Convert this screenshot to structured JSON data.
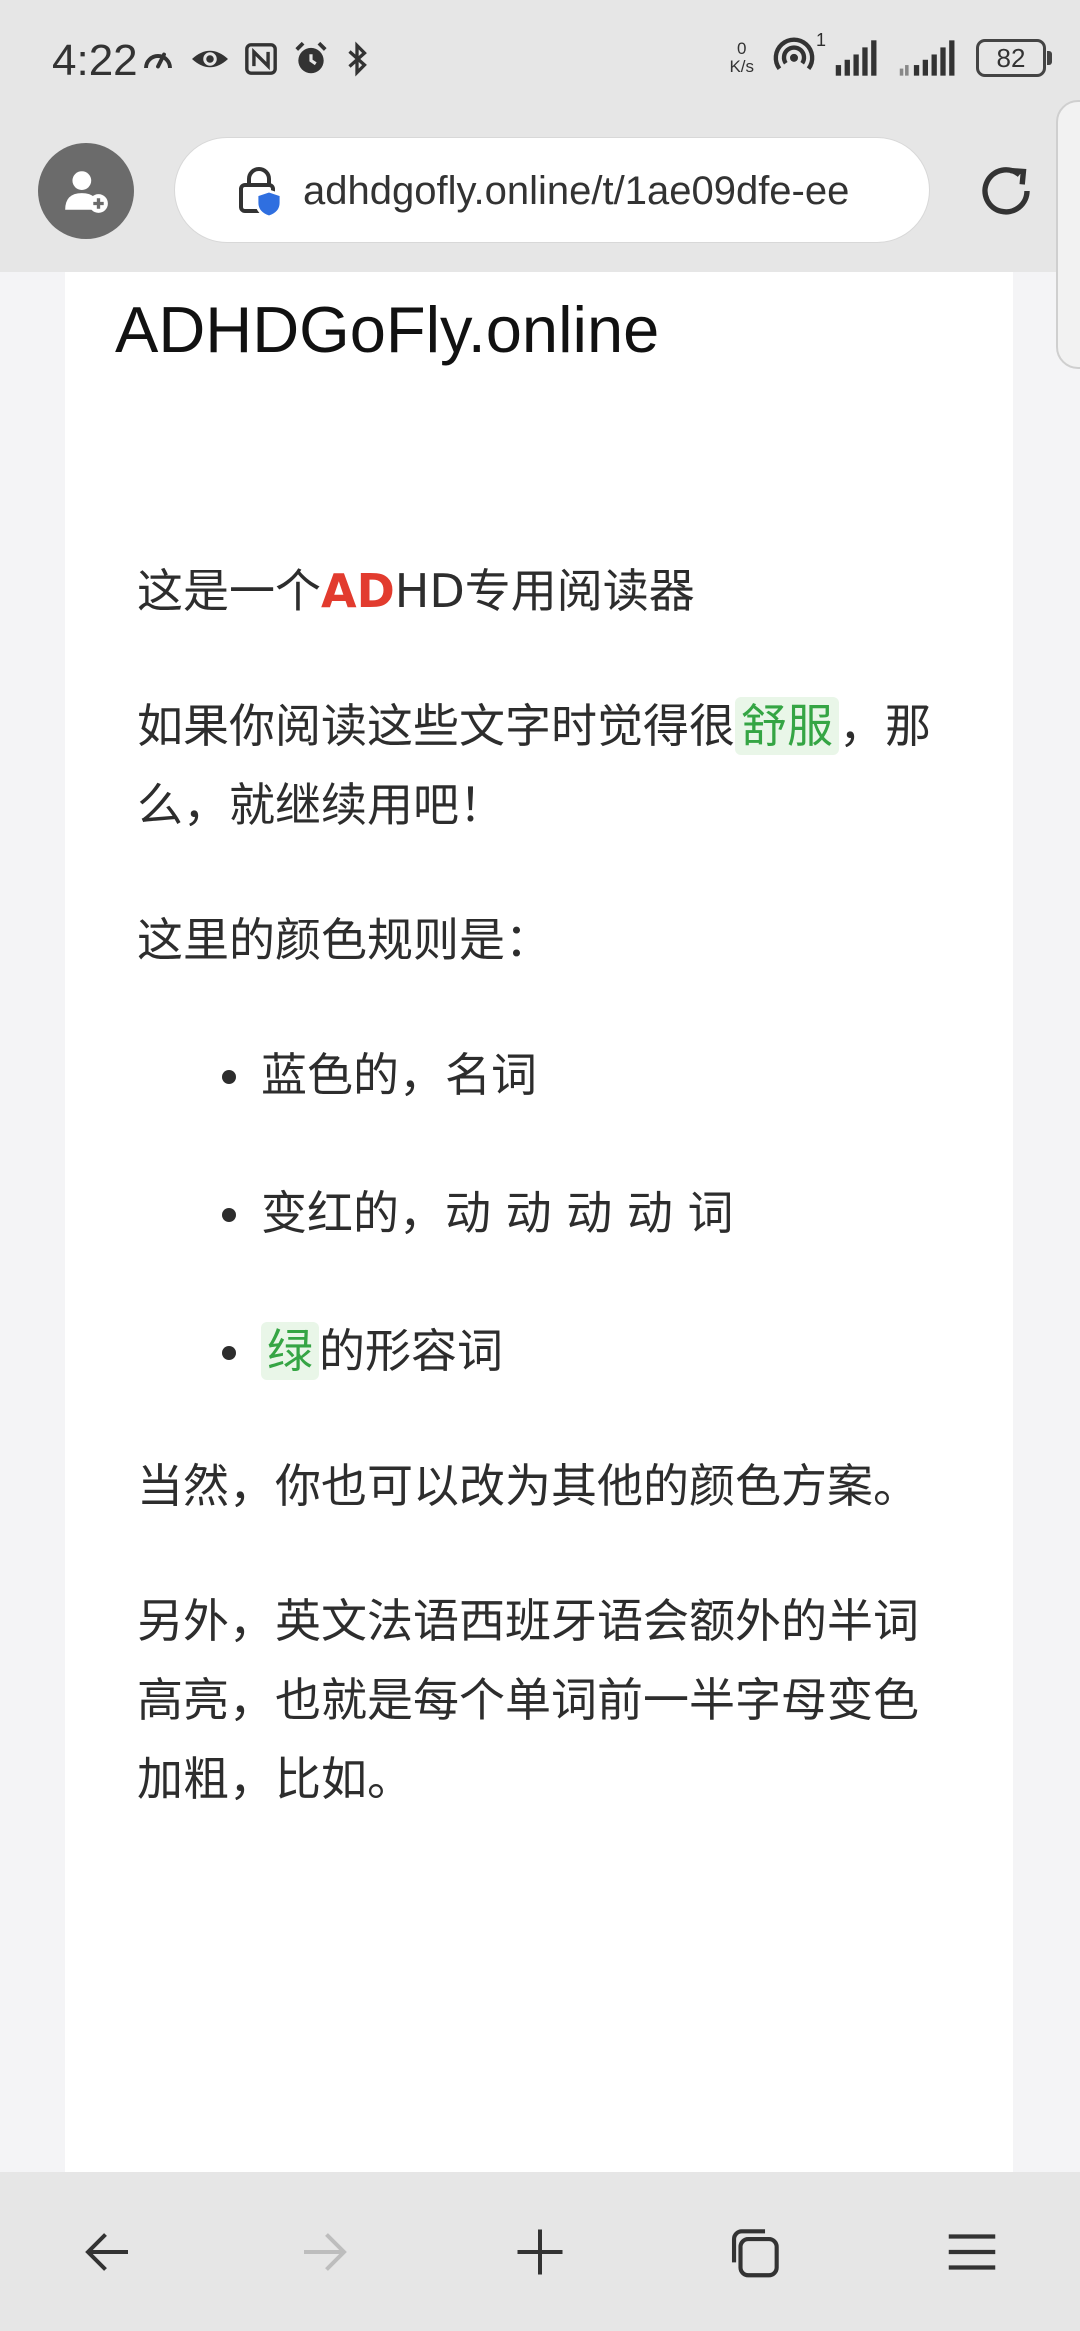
{
  "status_bar": {
    "time": "4:22",
    "net_speed_value": "0",
    "net_speed_unit": "K/s",
    "hotspot_count": "1",
    "battery": "82",
    "left_icons": [
      "speedometer-icon",
      "eye-icon",
      "nfc-icon",
      "alarm-icon",
      "bluetooth-icon"
    ],
    "right_icons": [
      "hotspot-icon",
      "signal-icon",
      "signal-icon"
    ]
  },
  "browser": {
    "url": "adhdgofly.online/t/1ae09dfe-ee",
    "icons": [
      "profile-icon",
      "lock-shield-icon",
      "reload-icon"
    ]
  },
  "page": {
    "site_title": "ADHDGoFly.online",
    "intro": {
      "before": "这是一个",
      "highlight": "AD",
      "after": "HD专用阅读器"
    },
    "comfort": {
      "before": "如果你阅读这些文字时觉得很",
      "highlight": "舒服",
      "after": "，那么，就继续用吧！"
    },
    "rules_title": "这里的颜色规则是：",
    "rules": {
      "noun": "蓝色的，名词",
      "verb": "变红的，动 动 动 动 词",
      "adj_highlight": "绿",
      "adj_after": "的形容词"
    },
    "change_scheme": "当然，你也可以改为其他的颜色方案。",
    "bionic_note": "另外，英文法语西班牙语会额外的半词高亮，也就是每个单词前一半字母变色加粗，比如。"
  },
  "bottom_nav": {
    "icons": [
      "back-arrow-icon",
      "forward-arrow-icon",
      "new-tab-icon",
      "tabs-icon",
      "menu-icon"
    ]
  },
  "colors": {
    "verb_red": "#e23b2e",
    "adjective_green": "#35a544",
    "chip_bg": "#e9f6e8",
    "bar_gray": "#e6e6e6"
  }
}
